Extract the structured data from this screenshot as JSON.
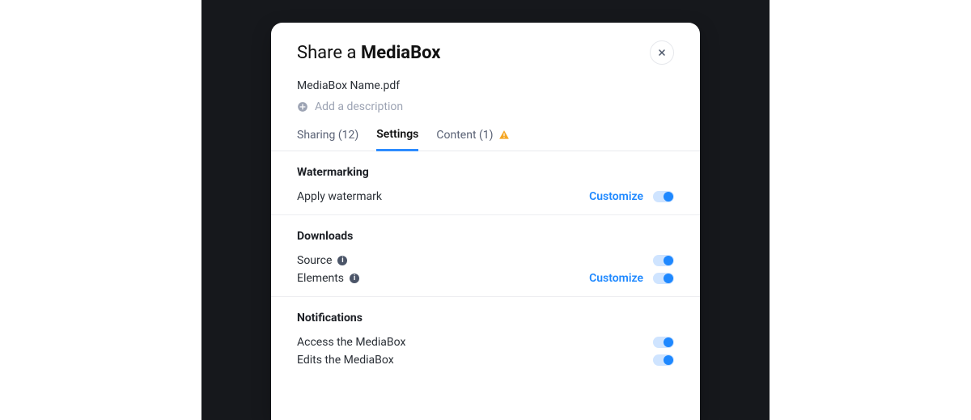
{
  "title": {
    "prefix": "Share a ",
    "bold": "MediaBox"
  },
  "file_name": "MediaBox Name.pdf",
  "add_description": "Add a description",
  "tabs": {
    "sharing": "Sharing (12)",
    "settings": "Settings",
    "content": "Content (1)"
  },
  "sections": {
    "watermarking": {
      "title": "Watermarking",
      "apply": "Apply watermark",
      "customize": "Customize"
    },
    "downloads": {
      "title": "Downloads",
      "source": "Source",
      "elements": "Elements",
      "customize": "Customize"
    },
    "notifications": {
      "title": "Notifications",
      "access": "Access the MediaBox",
      "edits": "Edits the MediaBox"
    }
  },
  "info_glyph": "i"
}
